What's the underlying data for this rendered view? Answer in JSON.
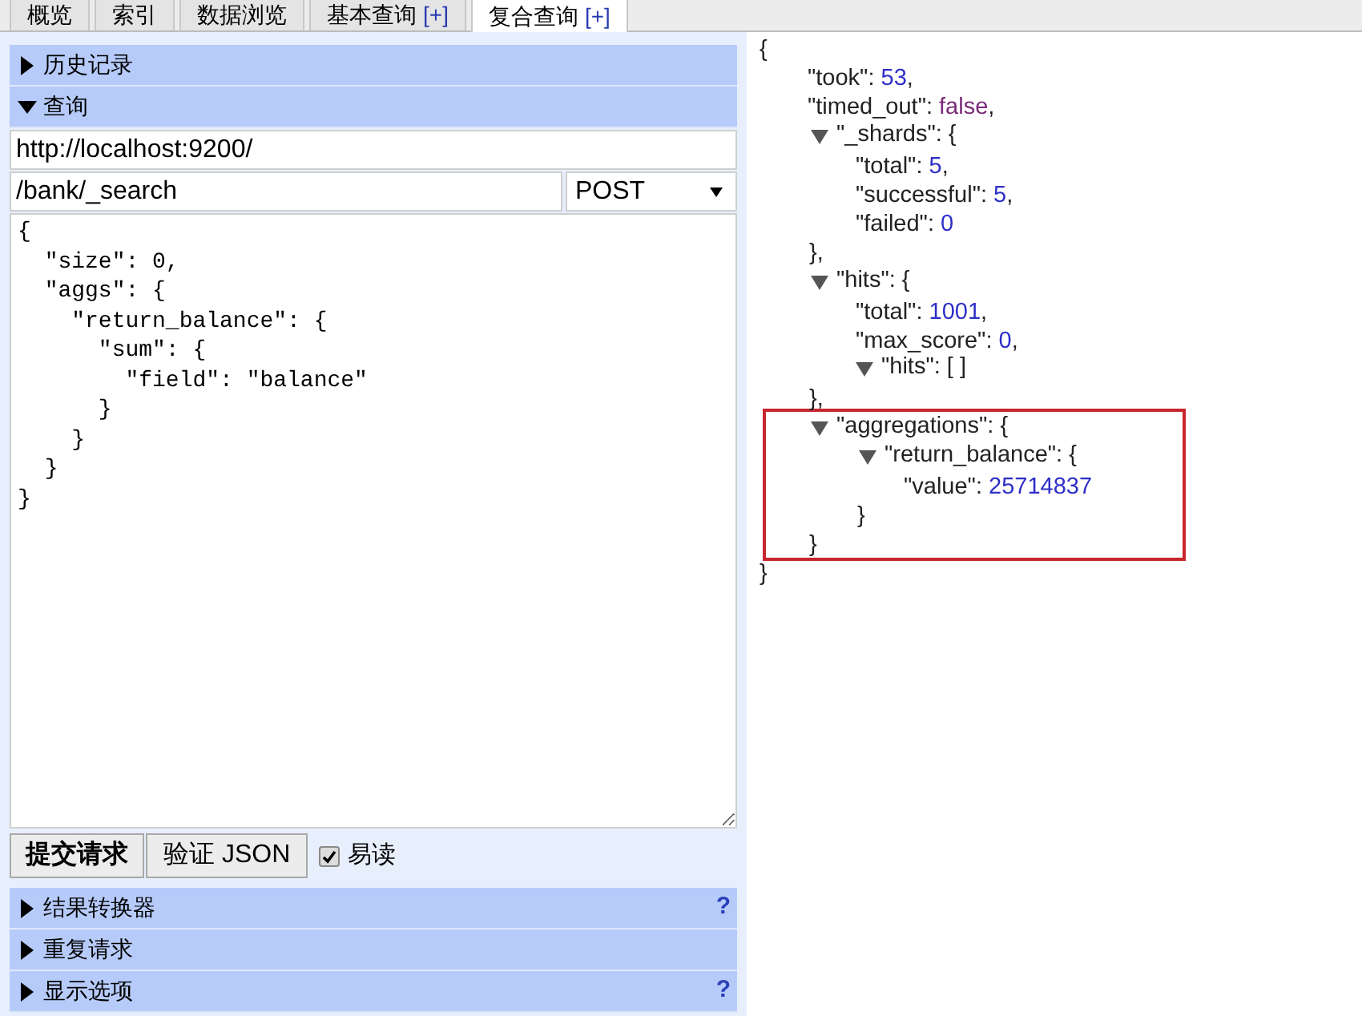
{
  "tabs": [
    {
      "label": "概览",
      "selected": false
    },
    {
      "label": "索引",
      "selected": false
    },
    {
      "label": "数据浏览",
      "selected": false
    },
    {
      "label": "基本查询",
      "plus": "[+]",
      "selected": false
    },
    {
      "label": "复合查询",
      "plus": "[+]",
      "selected": true
    }
  ],
  "sections_top": [
    {
      "label": "历史记录",
      "expanded": false
    },
    {
      "label": "查询",
      "expanded": true
    }
  ],
  "query": {
    "url": "http://localhost:9200/",
    "path": "/bank/_search",
    "method": "POST",
    "body": "{\n  \"size\": 0,\n  \"aggs\": {\n    \"return_balance\": {\n      \"sum\": {\n        \"field\": \"balance\"\n      }\n    }\n  }\n}",
    "submit": "提交请求",
    "validate": "验证 JSON",
    "pretty": {
      "label": "易读",
      "checked": true
    }
  },
  "sections_bottom": [
    {
      "label": "结果转换器",
      "expanded": false,
      "help": "?"
    },
    {
      "label": "重复请求",
      "expanded": false
    },
    {
      "label": "显示选项",
      "expanded": false,
      "help": "?"
    }
  ],
  "result": {
    "open": "{",
    "close": "}",
    "children": [
      {
        "kind": "number",
        "key": "\"took\": ",
        "value": "53",
        "tail": ","
      },
      {
        "kind": "boolean",
        "key": "\"timed_out\": ",
        "value": "false",
        "tail": ","
      },
      {
        "kind": "object",
        "key": "\"_shards\": ",
        "open": "{",
        "close": "},",
        "expanded": true,
        "highlighted": false,
        "children": [
          {
            "kind": "number",
            "key": "\"total\": ",
            "value": "5",
            "tail": ","
          },
          {
            "kind": "number",
            "key": "\"successful\": ",
            "value": "5",
            "tail": ","
          },
          {
            "kind": "number",
            "key": "\"failed\": ",
            "value": "0"
          }
        ]
      },
      {
        "kind": "object",
        "key": "\"hits\": ",
        "open": "{",
        "close": "},",
        "expanded": true,
        "highlighted": false,
        "children": [
          {
            "kind": "number",
            "key": "\"total\": ",
            "value": "1001",
            "tail": ","
          },
          {
            "kind": "number",
            "key": "\"max_score\": ",
            "value": "0",
            "tail": ","
          },
          {
            "kind": "array",
            "key": "\"hits\": ",
            "open": "[ ]",
            "expanded": true
          }
        ]
      },
      {
        "kind": "object",
        "key": "\"aggregations\": ",
        "open": "{",
        "close": "}",
        "expanded": true,
        "highlighted": true,
        "children": [
          {
            "kind": "object",
            "key": "\"return_balance\": ",
            "open": "{",
            "close": "}",
            "expanded": true,
            "highlighted": false,
            "children": [
              {
                "kind": "number",
                "key": "\"value\": ",
                "value": "25714837"
              }
            ]
          }
        ]
      }
    ]
  }
}
